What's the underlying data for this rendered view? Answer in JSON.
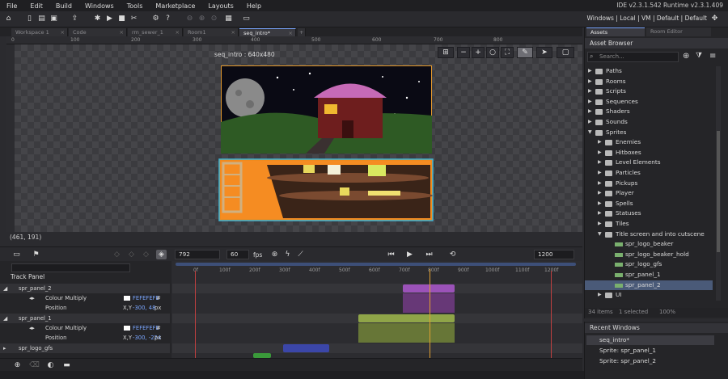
{
  "menu": [
    "File",
    "Edit",
    "Build",
    "Windows",
    "Tools",
    "Marketplace",
    "Layouts",
    "Help"
  ],
  "version_text": "IDE v2.3.1.542  Runtime v2.3.1.409",
  "target_text": "Windows | Local | VM | Default | Default",
  "tabs": [
    {
      "label": "Workspace 1"
    },
    {
      "label": "Code"
    },
    {
      "label": "rm_sewer_1"
    },
    {
      "label": "Room1"
    },
    {
      "label": "seq_intro*"
    }
  ],
  "ruler_labels": [
    "0",
    "100",
    "200",
    "300",
    "400",
    "500",
    "600",
    "700",
    "800"
  ],
  "seq_title": "seq_intro : 640x480",
  "cursor_coords": "(461, 191)",
  "assets": {
    "tabs": [
      "Assets",
      "Room Editor"
    ],
    "header": "Asset Browser",
    "search_placeholder": "Search...",
    "tree": [
      {
        "label": "Paths",
        "level": 0,
        "expanded": false
      },
      {
        "label": "Rooms",
        "level": 0,
        "expanded": false
      },
      {
        "label": "Scripts",
        "level": 0,
        "expanded": false
      },
      {
        "label": "Sequences",
        "level": 0,
        "expanded": false
      },
      {
        "label": "Shaders",
        "level": 0,
        "expanded": false
      },
      {
        "label": "Sounds",
        "level": 0,
        "expanded": false
      },
      {
        "label": "Sprites",
        "level": 0,
        "expanded": true
      },
      {
        "label": "Enemies",
        "level": 1,
        "expanded": false
      },
      {
        "label": "Hitboxes",
        "level": 1,
        "expanded": false
      },
      {
        "label": "Level Elements",
        "level": 1,
        "expanded": false
      },
      {
        "label": "Particles",
        "level": 1,
        "expanded": false
      },
      {
        "label": "Pickups",
        "level": 1,
        "expanded": false
      },
      {
        "label": "Player",
        "level": 1,
        "expanded": false
      },
      {
        "label": "Spells",
        "level": 1,
        "expanded": false
      },
      {
        "label": "Statuses",
        "level": 1,
        "expanded": false
      },
      {
        "label": "Tiles",
        "level": 1,
        "expanded": false
      },
      {
        "label": "Title screen and into cutscene",
        "level": 1,
        "expanded": true
      },
      {
        "label": "spr_logo_beaker",
        "level": 2,
        "sprite": true
      },
      {
        "label": "spr_logo_beaker_hold",
        "level": 2,
        "sprite": true
      },
      {
        "label": "spr_logo_gfs",
        "level": 2,
        "sprite": true
      },
      {
        "label": "spr_panel_1",
        "level": 2,
        "sprite": true
      },
      {
        "label": "spr_panel_2",
        "level": 2,
        "sprite": true,
        "selected": true
      },
      {
        "label": "UI",
        "level": 1,
        "expanded": false
      }
    ],
    "status_items": "34 items",
    "status_selected": "1 selected",
    "status_zoom": "100%"
  },
  "recent": {
    "header": "Recent Windows",
    "items": [
      "seq_intro*",
      "Sprite: spr_panel_1",
      "Sprite: spr_panel_2"
    ]
  },
  "timeline": {
    "frame": "792",
    "fps_value": "60",
    "fps_label": "fps",
    "length": "1200",
    "track_panel_label": "Track Panel",
    "ticks": [
      "0f",
      "100f",
      "200f",
      "300f",
      "400f",
      "500f",
      "600f",
      "700f",
      "800f",
      "900f",
      "1000f",
      "1100f",
      "1200f"
    ],
    "tracks": [
      {
        "name": "spr_panel_2",
        "kind": "track"
      },
      {
        "name": "Colour Multiply",
        "value": "FEFEFEFE",
        "suffix": "#",
        "kind": "param"
      },
      {
        "name": "Position",
        "value": "-300, 48",
        "suffix": "px",
        "xy": "X,Y",
        "kind": "param"
      },
      {
        "name": "spr_panel_1",
        "kind": "track"
      },
      {
        "name": "Colour Multiply",
        "value": "FEFEFEFE",
        "suffix": "#",
        "kind": "param"
      },
      {
        "name": "Position",
        "value": "-300, -224",
        "suffix": "px",
        "xy": "X,Y",
        "kind": "param"
      },
      {
        "name": "spr_logo_gfs",
        "kind": "track"
      }
    ]
  },
  "colors": {
    "accent": "#7aa6ff",
    "panel_bg": "#252528",
    "purple_key": "#9b52b8",
    "olive_key": "#8fa548",
    "blue_key": "#3b46a8",
    "green_key": "#3a9a3a"
  }
}
